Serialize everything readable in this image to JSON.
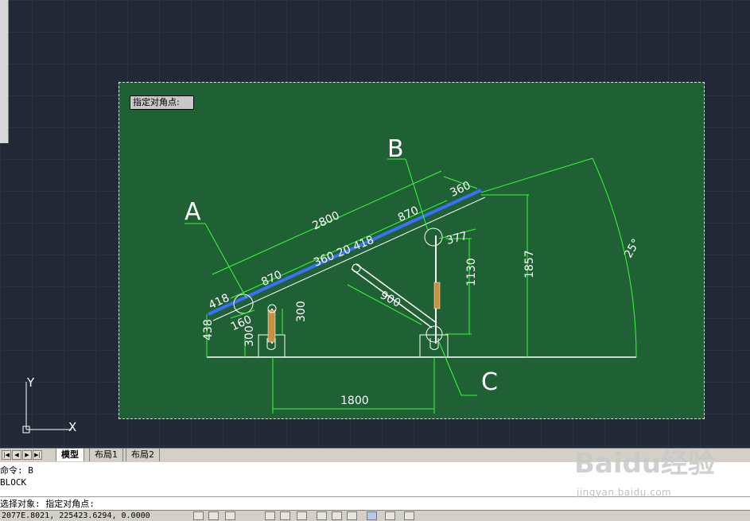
{
  "tooltip": {
    "label": "指定对角点:"
  },
  "drawing": {
    "letters": {
      "a": "A",
      "b": "B",
      "c": "C"
    },
    "dims": {
      "d2800": "2800",
      "d360_top": "360",
      "d870_top": "870",
      "d377": "377",
      "d1857": "1857",
      "d1130": "1130",
      "d360_20_418": "360 20 418",
      "d870_left": "870",
      "d418": "418",
      "d900": "900",
      "d160": "160",
      "d300_mid": "300",
      "d300_left": "300",
      "d438": "438",
      "d1800": "1800",
      "angle": "25°"
    }
  },
  "ucs": {
    "y_label": "Y",
    "x_label": "X"
  },
  "tabs": {
    "nav_first": "|◀",
    "nav_prev": "◀",
    "nav_next": "▶",
    "nav_last": "▶|",
    "model": "模型",
    "layout1": "布局1",
    "layout2": "布局2"
  },
  "command": {
    "line1": "命令: B",
    "line2": "BLOCK",
    "line3": "选择对象: 指定对角点:"
  },
  "status": {
    "coords": "2077E.8021, 225423.6294, 0.0000"
  },
  "watermark": {
    "brand": "Baidu经验",
    "url": "jingyan.baidu.com"
  },
  "colors": {
    "canvas": "#222836",
    "selection": "#1f6135",
    "lines": "#ffffff",
    "dims": "#33ff33"
  }
}
